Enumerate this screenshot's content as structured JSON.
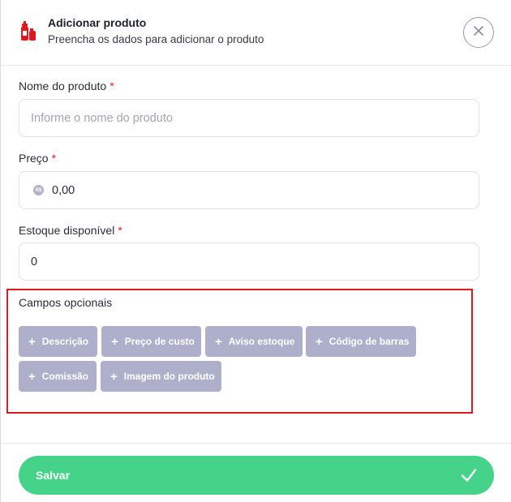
{
  "header": {
    "title": "Adicionar produto",
    "subtitle": "Preencha os dados para adicionar o produto",
    "icon": "product-bottles-icon",
    "close_icon": "close-icon"
  },
  "fields": {
    "name": {
      "label": "Nome do produto",
      "required_mark": "*",
      "placeholder": "Informe o nome do produto",
      "value": ""
    },
    "price": {
      "label": "Preço",
      "required_mark": "*",
      "currency_symbol": "R$",
      "value": "0,00"
    },
    "stock": {
      "label": "Estoque disponível",
      "required_mark": "*",
      "value": "0"
    }
  },
  "optional": {
    "title": "Campos opcionais",
    "chips": [
      "Descrição",
      "Preço de custo",
      "Aviso estoque",
      "Código de barras",
      "Comissão",
      "Imagem do produto"
    ],
    "chip_prefix": "+"
  },
  "footer": {
    "save_label": "Salvar",
    "save_icon": "checkmark-icon"
  },
  "colors": {
    "accent_red": "#e0191e",
    "save_green": "#45d38a",
    "chip_bg": "#aeb0cb",
    "required_red": "#e02424"
  }
}
